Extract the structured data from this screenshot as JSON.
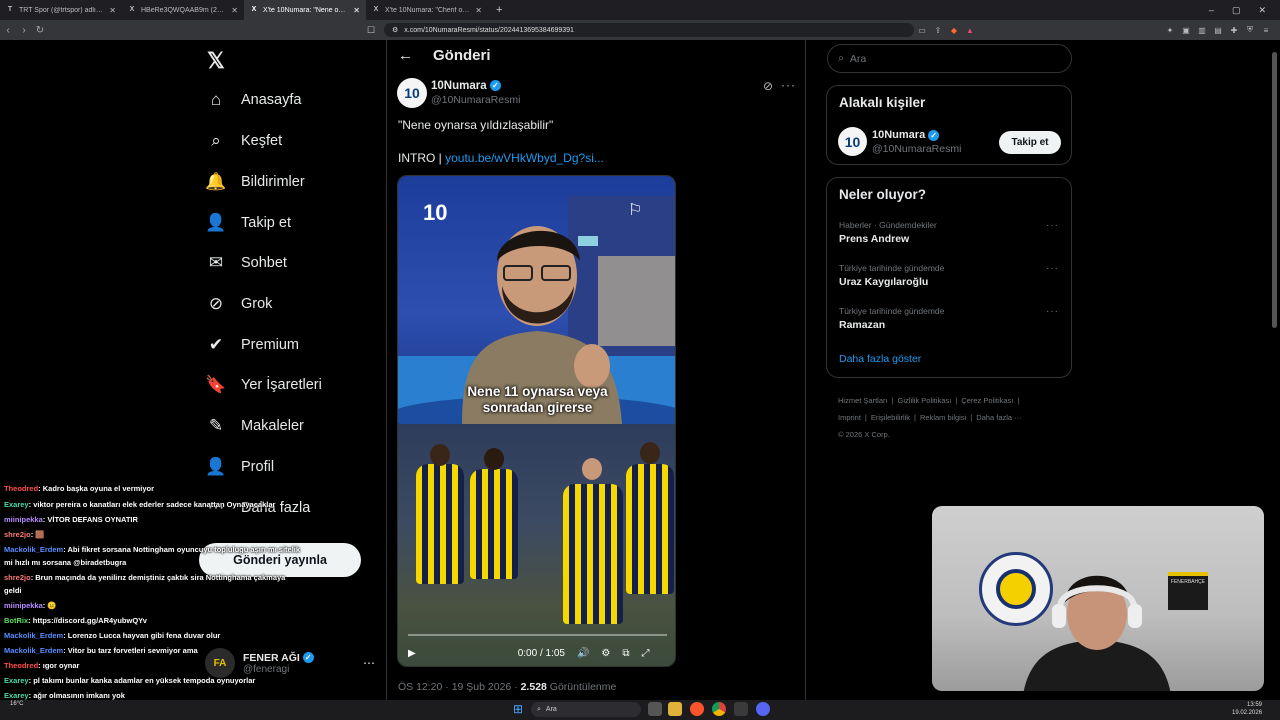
{
  "browser": {
    "tabs": [
      {
        "icon": "T",
        "title": "TRT Spor (@trtspor) adlı kullanıcının",
        "active": false
      },
      {
        "icon": "X",
        "title": "HBeRe3QWQAAB9m (2160×2700)",
        "active": false
      },
      {
        "icon": "X",
        "title": "X'te 10Numara: \"Nene oynarsa",
        "active": true
      },
      {
        "icon": "X",
        "title": "X'te 10Numara: \"Cherif oynayacak mı",
        "active": false
      }
    ],
    "new_tab": "+",
    "url": "x.com/10NumaraResmi/status/2024413695384699391"
  },
  "sidebar": {
    "logo": "𝕏",
    "items": [
      {
        "icon": "⌂",
        "label": "Anasayfa"
      },
      {
        "icon": "⌕",
        "label": "Keşfet"
      },
      {
        "icon": "🔔",
        "label": "Bildirimler"
      },
      {
        "icon": "👤",
        "label": "Takip et"
      },
      {
        "icon": "✉",
        "label": "Sohbet"
      },
      {
        "icon": "⊘",
        "label": "Grok"
      },
      {
        "icon": "✔",
        "label": "Premium"
      },
      {
        "icon": "🔖",
        "label": "Yer İşaretleri"
      },
      {
        "icon": "✎",
        "label": "Makaleler"
      },
      {
        "icon": "👤",
        "label": "Profil"
      },
      {
        "icon": "⋯",
        "label": "Daha fazla"
      }
    ],
    "post_button": "Gönderi yayınla",
    "account": {
      "name": "FENER AĞI",
      "handle": "@feneragi",
      "more": "⋯"
    }
  },
  "main": {
    "back": "←",
    "title": "Gönderi",
    "author": {
      "avatar": "10",
      "name": "10Numara",
      "handle": "@10NumaraResmi"
    },
    "text": "\"Nene oynarsa yıldızlaşabilir\"",
    "link_prefix": "INTRO | ",
    "link": "youtu.be/wVHkWbyd_Dg?si...",
    "video": {
      "logo": "10",
      "caption_line1": "Nene 11 oynarsa veya",
      "caption_line2": "sonradan girerse",
      "time": "0:00 / 1:05",
      "progress": 0.0
    },
    "meta_time": "ÖS 12:20 · 19 Şub 2026 · ",
    "meta_views": "2.528",
    "meta_views_label": " Görüntülenme"
  },
  "right": {
    "search_placeholder": "Ara",
    "related_title": "Alakalı kişiler",
    "related": {
      "avatar": "10",
      "name": "10Numara",
      "handle": "@10NumaraResmi",
      "follow": "Takip et"
    },
    "trends_title": "Neler oluyor?",
    "trends": [
      {
        "meta": "Haberler · Gündemdekiler",
        "name": "Prens Andrew"
      },
      {
        "meta": "Türkiye tarihinde gündemde",
        "name": "Uraz Kaygılaroğlu"
      },
      {
        "meta": "Türkiye tarihinde gündemde",
        "name": "Ramazan"
      }
    ],
    "show_more": "Daha fazla göster",
    "footer": [
      "Hizmet Şartları",
      "Gizlilik Politikası",
      "Çerez Politikası",
      "Imprint",
      "Erişilebilirlik",
      "Reklam bilgisi",
      "Daha fazla ···"
    ],
    "copyright": "© 2026 X Corp."
  },
  "chat": [
    {
      "user": "Theodred",
      "color": "#ff4d4d",
      "msg": ": Kadro başka oyuna el vermiyor"
    },
    {
      "user": "Exarey",
      "color": "#4dd9a6",
      "msg": ": viktor pereira o kanatları elek ederler sadece kanattan Oynayacaklar"
    },
    {
      "user": "miinipekka",
      "color": "#b78cff",
      "msg": ": VİTOR DEFANS OYNATIR"
    },
    {
      "user": "shre2jo",
      "color": "#ff7a7a",
      "msg": ": 🟫"
    },
    {
      "user": "Mackolik_Erdem",
      "color": "#5a8dff",
      "msg": ": Abi fikret sorsana Nottingham oyuncuyu toplulugu aşırı mı sitelik"
    },
    {
      "user": "",
      "color": "#ffffff",
      "msg": "mi hızlı mı sorsana @biradetbugra"
    },
    {
      "user": "shre2jo",
      "color": "#ff7a7a",
      "msg": ": Brun maçında da yenilirız demiştiniz çaktık sira Nottinghama çakmaya"
    },
    {
      "user": "",
      "color": "#ffffff",
      "msg": "geldi"
    },
    {
      "user": "miinipekka",
      "color": "#b78cff",
      "msg": ": 😐"
    },
    {
      "user": "BotRix",
      "color": "#5ee05e",
      "msg": ": https://discord.gg/AR4yubwQYv"
    },
    {
      "user": "Mackolik_Erdem",
      "color": "#5a8dff",
      "msg": ": Lorenzo Lucca hayvan gibi fena duvar olur"
    },
    {
      "user": "Mackolik_Erdem",
      "color": "#5a8dff",
      "msg": ": Vitor bu tarz forvetleri sevmiyor ama"
    },
    {
      "user": "Theodred",
      "color": "#ff4d4d",
      "msg": ": ıgor oynar"
    },
    {
      "user": "Exarey",
      "color": "#4dd9a6",
      "msg": ": pl takımı bunlar kanka adamlar en yüksek tempoda oynuyorlar"
    },
    {
      "user": "Exarey",
      "color": "#4dd9a6",
      "msg": ": ağır olmasının imkanı yok"
    },
    {
      "user": "Mackolik_Erdem",
      "color": "#5a8dff",
      "msg": ": Fikret kaç kaç biter abi"
    }
  ],
  "webcam": {
    "sign_text": "FENERBAHÇE"
  },
  "taskbar": {
    "search": "Ara",
    "weather": "16°C",
    "time": "13:59",
    "date": "19.02.2026"
  }
}
